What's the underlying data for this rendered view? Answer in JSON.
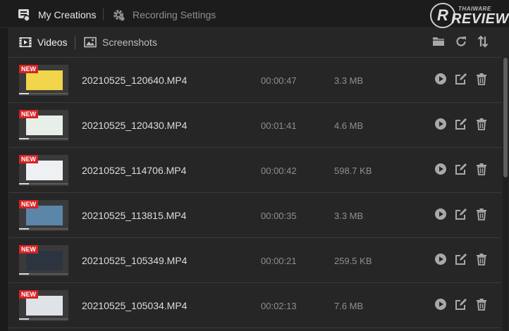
{
  "header": {
    "tab_creations": "My Creations",
    "tab_settings": "Recording Settings"
  },
  "watermark": {
    "small": "THAIWARE",
    "big": "REVIEW",
    "letter": "R"
  },
  "subtabs": {
    "videos": "Videos",
    "screenshots": "Screenshots"
  },
  "toolbar": {
    "icons": [
      "folder-icon",
      "refresh-icon",
      "sort-icon"
    ]
  },
  "badge_label": "NEW",
  "videos": [
    {
      "name": "20210525_120640.MP4",
      "duration": "00:00:47",
      "size": "3.3 MB",
      "thumb_color": "#f1d54a"
    },
    {
      "name": "20210525_120430.MP4",
      "duration": "00:01:41",
      "size": "4.6 MB",
      "thumb_color": "#e8efe9"
    },
    {
      "name": "20210525_114706.MP4",
      "duration": "00:00:42",
      "size": "598.7 KB",
      "thumb_color": "#eef1f4"
    },
    {
      "name": "20210525_113815.MP4",
      "duration": "00:00:35",
      "size": "3.3 MB",
      "thumb_color": "#5b86a8"
    },
    {
      "name": "20210525_105349.MP4",
      "duration": "00:00:21",
      "size": "259.5 KB",
      "thumb_color": "#2c3440"
    },
    {
      "name": "20210525_105034.MP4",
      "duration": "00:02:13",
      "size": "7.6 MB",
      "thumb_color": "#dfe3e8"
    }
  ],
  "colors": {
    "background": "#1b1b1b",
    "panel": "#262626",
    "badge": "#d42424",
    "icon": "#a8a8a8"
  }
}
